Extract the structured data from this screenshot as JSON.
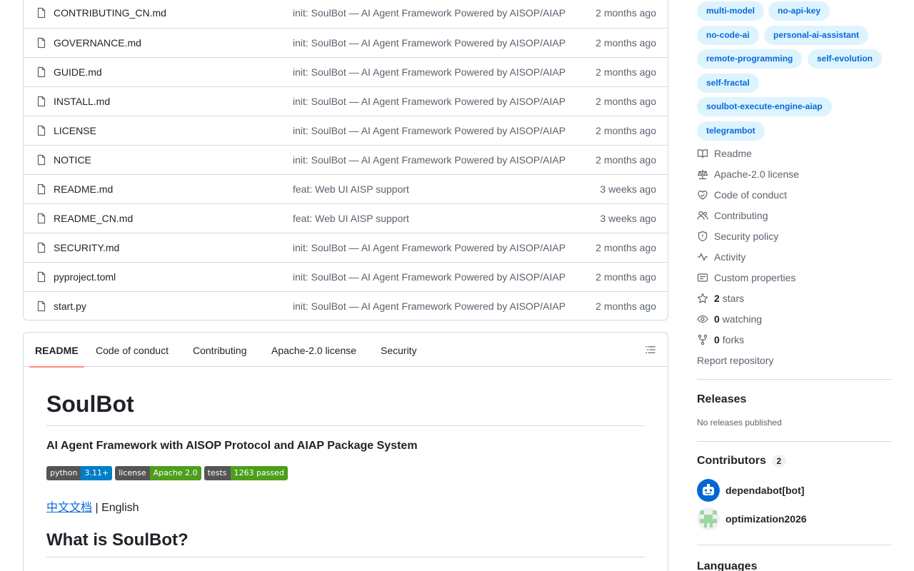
{
  "files": [
    {
      "name": "CONTRIBUTING_CN.md",
      "message": "init: SoulBot — AI Agent Framework Powered by AISOP/AIAP",
      "age": "2 months ago"
    },
    {
      "name": "GOVERNANCE.md",
      "message": "init: SoulBot — AI Agent Framework Powered by AISOP/AIAP",
      "age": "2 months ago"
    },
    {
      "name": "GUIDE.md",
      "message": "init: SoulBot — AI Agent Framework Powered by AISOP/AIAP",
      "age": "2 months ago"
    },
    {
      "name": "INSTALL.md",
      "message": "init: SoulBot — AI Agent Framework Powered by AISOP/AIAP",
      "age": "2 months ago"
    },
    {
      "name": "LICENSE",
      "message": "init: SoulBot — AI Agent Framework Powered by AISOP/AIAP",
      "age": "2 months ago"
    },
    {
      "name": "NOTICE",
      "message": "init: SoulBot — AI Agent Framework Powered by AISOP/AIAP",
      "age": "2 months ago"
    },
    {
      "name": "README.md",
      "message": "feat: Web UI AISP support",
      "age": "3 weeks ago"
    },
    {
      "name": "README_CN.md",
      "message": "feat: Web UI AISP support",
      "age": "3 weeks ago"
    },
    {
      "name": "SECURITY.md",
      "message": "init: SoulBot — AI Agent Framework Powered by AISOP/AIAP",
      "age": "2 months ago"
    },
    {
      "name": "pyproject.toml",
      "message": "init: SoulBot — AI Agent Framework Powered by AISOP/AIAP",
      "age": "2 months ago"
    },
    {
      "name": "start.py",
      "message": "init: SoulBot — AI Agent Framework Powered by AISOP/AIAP",
      "age": "2 months ago"
    }
  ],
  "readme": {
    "tabs": [
      "README",
      "Code of conduct",
      "Contributing",
      "Apache-2.0 license",
      "Security"
    ],
    "active_tab": "README",
    "title": "SoulBot",
    "subtitle": "AI Agent Framework with AISOP Protocol and AIAP Package System",
    "badges": [
      {
        "label": "python",
        "value": "3.11+",
        "color": "#007ec6"
      },
      {
        "label": "license",
        "value": "Apache 2.0",
        "color": "#4c9e1c"
      },
      {
        "label": "tests",
        "value": "1263 passed",
        "color": "#4c9e1c"
      }
    ],
    "lang_link": "中文文档",
    "lang_rest": " | English",
    "section_heading": "What is SoulBot?"
  },
  "sidebar": {
    "topics": [
      "multi-model",
      "no-api-key",
      "no-code-ai",
      "personal-ai-assistant",
      "remote-programming",
      "self-evolution",
      "self-fractal",
      "soulbot-execute-engine-aiap",
      "telegrambot"
    ],
    "links": {
      "readme": "Readme",
      "license": "Apache-2.0 license",
      "conduct": "Code of conduct",
      "contributing": "Contributing",
      "security": "Security policy",
      "activity": "Activity",
      "custom_props": "Custom properties",
      "stars_count": "2",
      "stars_label": "stars",
      "watching_count": "0",
      "watching_label": "watching",
      "forks_count": "0",
      "forks_label": "forks",
      "report": "Report repository"
    },
    "releases": {
      "heading": "Releases",
      "empty": "No releases published"
    },
    "contributors": {
      "heading": "Contributors",
      "count": "2",
      "people": [
        {
          "name": "dependabot[bot]"
        },
        {
          "name": "optimization2026"
        }
      ]
    },
    "languages_heading": "Languages"
  },
  "colors": {
    "link": "#0969da",
    "topic_bg": "#ddf4ff",
    "tab_underline": "#fd8c73",
    "border": "#d1d9e0",
    "muted": "#59636e"
  }
}
